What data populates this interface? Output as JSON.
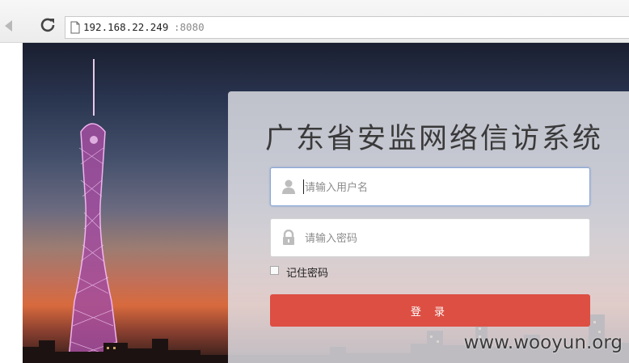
{
  "browser": {
    "url_host": "192.168.22.249",
    "url_port": ":8080"
  },
  "login": {
    "title": "广东省安监网络信访系统",
    "username_placeholder": "请输入用户名",
    "password_placeholder": "请输入密码",
    "remember_label": "记住密码",
    "submit_label": "登 录"
  },
  "colors": {
    "accent": "#dd4f43"
  },
  "watermark": "www.wooyun.org"
}
